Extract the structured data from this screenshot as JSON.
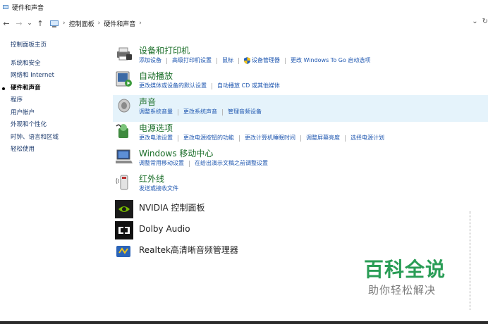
{
  "window": {
    "title": "硬件和声音"
  },
  "address": {
    "back": "←",
    "forward": "→",
    "recent": "⌄",
    "up": "↑",
    "crumbs": [
      "控制面板",
      "硬件和声音"
    ],
    "dropdown": "⌄",
    "refresh": "↻"
  },
  "sidebar": {
    "home": "控制面板主页",
    "items": [
      "系统和安全",
      "网络和 Internet",
      "硬件和声音",
      "程序",
      "用户帐户",
      "外观和个性化",
      "时钟、语言和区域",
      "轻松使用"
    ],
    "active_index": 2
  },
  "categories": [
    {
      "title": "设备和打印机",
      "links": [
        "添加设备",
        "高级打印机设置",
        "鼠标",
        "设备管理器",
        "更改 Windows To Go 启动选项"
      ]
    },
    {
      "title": "自动播放",
      "links": [
        "更改媒体或设备的默认设置",
        "自动播放 CD 或其他媒体"
      ]
    },
    {
      "title": "声音",
      "links": [
        "调整系统音量",
        "更改系统声音",
        "管理音频设备"
      ]
    },
    {
      "title": "电源选项",
      "links": [
        "更改电池设置",
        "更改电源按钮的功能",
        "更改计算机睡眠时间",
        "调整屏幕亮度",
        "选择电源计划"
      ]
    },
    {
      "title": "Windows 移动中心",
      "links": [
        "调整常用移动设置",
        "在给出演示文稿之前调整设置"
      ]
    },
    {
      "title": "红外线",
      "links": [
        "发送或接收文件"
      ]
    },
    {
      "title": "NVIDIA 控制面板",
      "links": []
    },
    {
      "title": "Dolby Audio",
      "links": []
    },
    {
      "title": "Realtek高清晰音频管理器",
      "links": []
    }
  ],
  "watermark": {
    "title": "百科全说",
    "subtitle": "助你轻松解决"
  },
  "colors": {
    "accent_title": "#1a6e28",
    "link": "#1f57b0",
    "hover_row": "#e5f3fb",
    "watermark": "#2a9d56"
  }
}
